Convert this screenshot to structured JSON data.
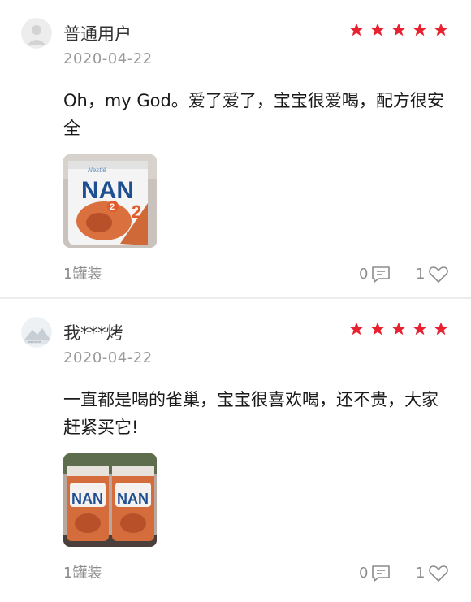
{
  "colors": {
    "star": "#e8202f",
    "date": "#9a9a9a",
    "meta": "#8c8c8c"
  },
  "icons": {
    "rating": "star-icon",
    "comment": "comment-icon",
    "like": "heart-icon"
  },
  "reviews": [
    {
      "username": "普通用户",
      "rating": 5,
      "date": "2020-04-22",
      "content": "Oh，my God。爱了爱了，宝宝很爱喝，配方很安全",
      "photo_brand_top": "Nestlé",
      "photo_brand": "NAN",
      "photo_stage": "2",
      "spec": "1罐装",
      "comment_count": "0",
      "like_count": "1"
    },
    {
      "username": "我***烤",
      "rating": 5,
      "date": "2020-04-22",
      "content": "一直都是喝的雀巢，宝宝很喜欢喝，还不贵，大家赶紧买它!",
      "photo_brand": "NAN",
      "spec": "1罐装",
      "comment_count": "0",
      "like_count": "1"
    }
  ]
}
